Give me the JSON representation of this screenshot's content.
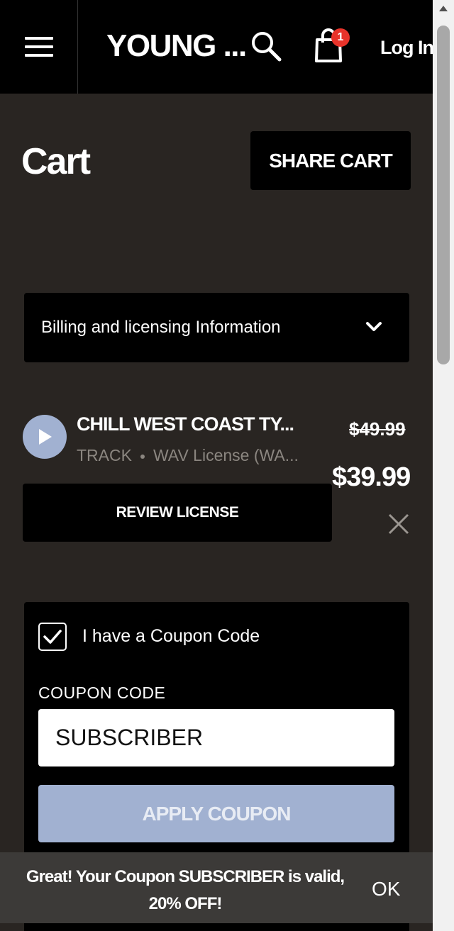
{
  "header": {
    "brand": "YOUNG ...",
    "cart_count": "1",
    "login_label": "Log In"
  },
  "page": {
    "title": "Cart",
    "share_label": "SHARE CART"
  },
  "billing": {
    "label": "Billing and licensing Information"
  },
  "item": {
    "title": "CHILL WEST COAST TY...",
    "type": "TRACK",
    "license": "WAV License (WA...",
    "price_old": "$49.99",
    "price_new": "$39.99",
    "review_label": "REVIEW LICENSE"
  },
  "coupon": {
    "checkbox_label": "I have a Coupon Code",
    "checked": true,
    "field_label": "COUPON CODE",
    "value": "SUBSCRIBER",
    "apply_label": "APPLY COUPON"
  },
  "toast": {
    "message": "Great! Your Coupon SUBSCRIBER is valid, 20% OFF!",
    "ok_label": "OK"
  },
  "colors": {
    "background": "#292522",
    "panel": "#000000",
    "accent": "#a1b1d1",
    "badge": "#e8332a",
    "muted_text": "#8b8680"
  },
  "icons": {
    "menu": "hamburger-icon",
    "search": "search-icon",
    "cart": "shopping-bag-icon",
    "chevron": "chevron-down-icon",
    "play": "play-icon",
    "remove": "close-icon",
    "check": "checkmark-icon"
  }
}
